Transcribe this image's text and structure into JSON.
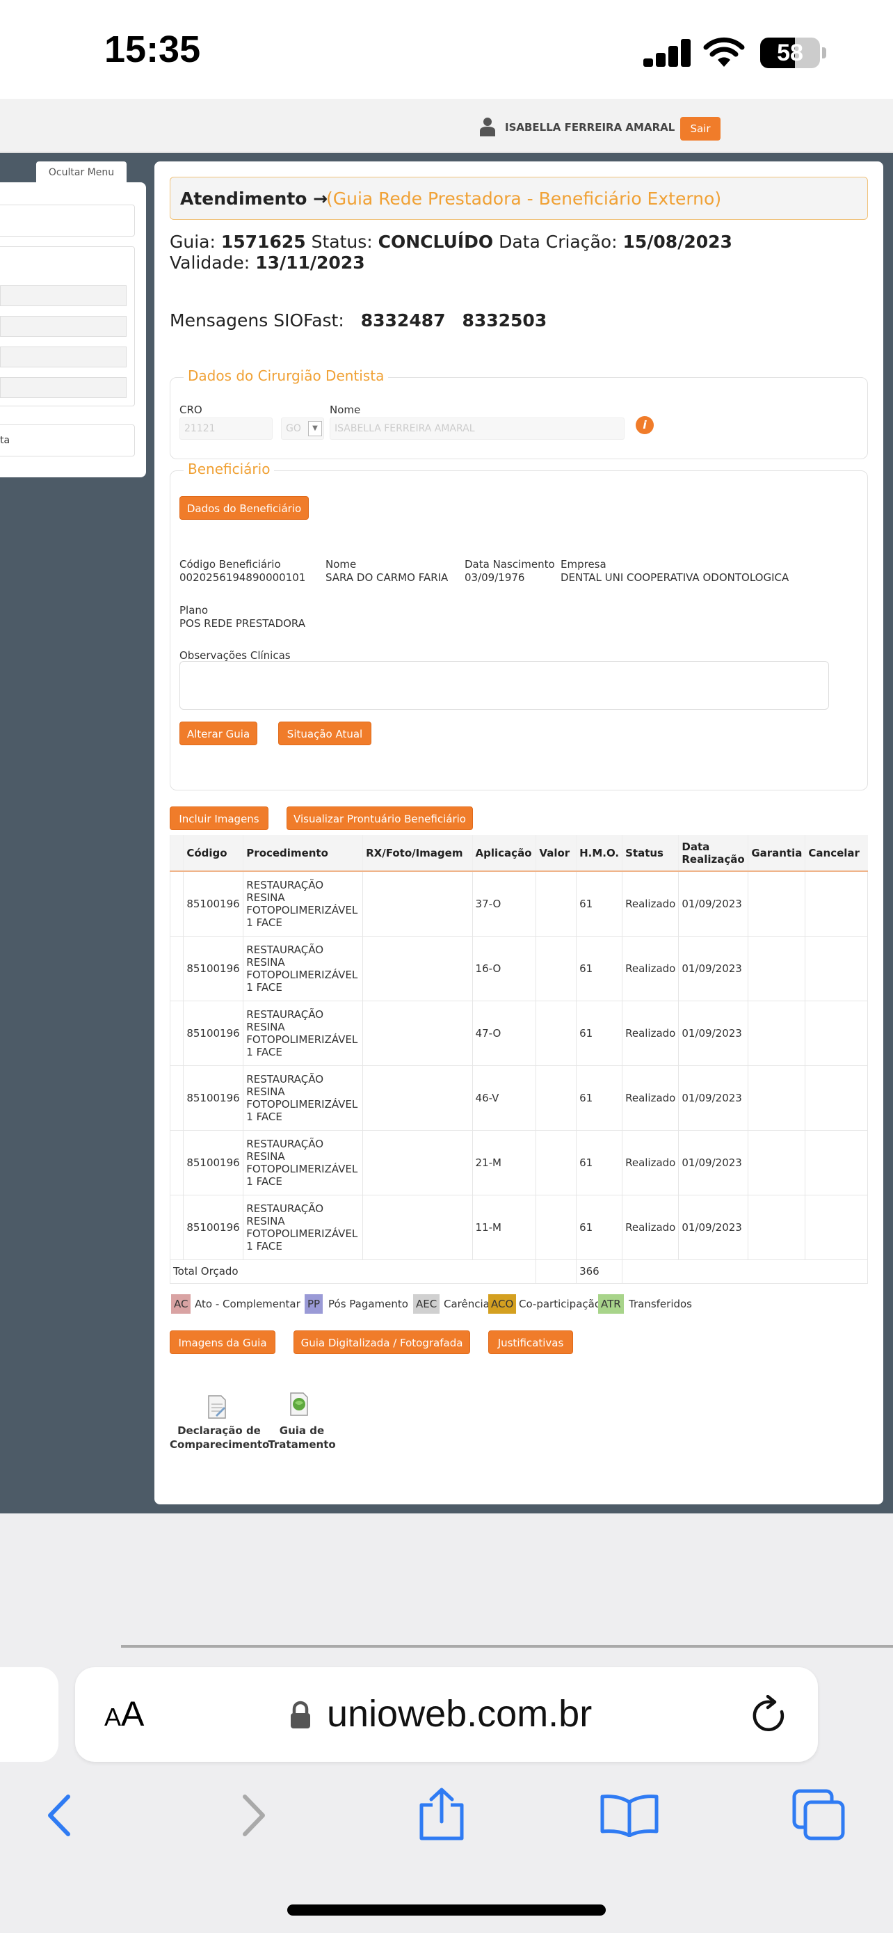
{
  "status_bar": {
    "time": "15:35",
    "battery": "58",
    "battery_level": 0.58
  },
  "header": {
    "user_name": "ISABELLA FERREIRA AMARAL",
    "logout_label": "Sair"
  },
  "sidebar": {
    "hide_menu_label": "Ocultar Menu",
    "partial_text": "ta"
  },
  "title": {
    "prefix": "Atendimento →",
    "context": "(Guia Rede Prestadora - Beneficiário Externo)"
  },
  "guia": {
    "guia_label": "Guia:",
    "guia_number": "1571625",
    "status_label": "Status:",
    "status_value": "CONCLUÍDO",
    "created_label": "Data Criação:",
    "created_value": "15/08/2023",
    "validity_label": "Validade:",
    "validity_value": "13/11/2023"
  },
  "messages": {
    "label": "Mensagens SIOFast:",
    "codes": [
      "8332487",
      "8332503"
    ]
  },
  "dentist": {
    "legend": "Dados do Cirurgião Dentista",
    "cro_label": "CRO",
    "cro_value": "21121",
    "uf_value": "GO",
    "name_label": "Nome",
    "name_value": "ISABELLA FERREIRA AMARAL"
  },
  "beneficiary": {
    "legend": "Beneficiário",
    "data_button": "Dados do Beneficiário",
    "code_label": "Código Beneficiário",
    "code_value": "0020256194890000101",
    "name_label": "Nome",
    "name_value": "SARA DO CARMO FARIA",
    "birth_label": "Data Nascimento",
    "birth_value": "03/09/1976",
    "company_label": "Empresa",
    "company_value": "DENTAL UNI COOPERATIVA ODONTOLOGICA",
    "plan_label": "Plano",
    "plan_value": "POS REDE PRESTADORA",
    "obs_label": "Observações Clínicas",
    "alter_button": "Alterar Guia",
    "situation_button": "Situação Atual"
  },
  "actions": {
    "include_images": "Incluir Imagens",
    "view_record": "Visualizar Prontuário Beneficiário"
  },
  "table": {
    "headers": [
      "Código",
      "Procedimento",
      "RX/Foto/Imagem",
      "Aplicação",
      "Valor",
      "H.M.O.",
      "Status",
      "Data Realização",
      "Garantia",
      "Cancelar"
    ],
    "rows": [
      {
        "code": "85100196",
        "procedure": "RESTAURAÇÃO RESINA FOTOPOLIMERIZÁVEL 1 FACE",
        "rx": "",
        "application": "37-O",
        "value": "",
        "hmo": "61",
        "status": "Realizado",
        "date": "01/09/2023"
      },
      {
        "code": "85100196",
        "procedure": "RESTAURAÇÃO RESINA FOTOPOLIMERIZÁVEL 1 FACE",
        "rx": "",
        "application": "16-O",
        "value": "",
        "hmo": "61",
        "status": "Realizado",
        "date": "01/09/2023"
      },
      {
        "code": "85100196",
        "procedure": "RESTAURAÇÃO RESINA FOTOPOLIMERIZÁVEL 1 FACE",
        "rx": "",
        "application": "47-O",
        "value": "",
        "hmo": "61",
        "status": "Realizado",
        "date": "01/09/2023"
      },
      {
        "code": "85100196",
        "procedure": "RESTAURAÇÃO RESINA FOTOPOLIMERIZÁVEL 1 FACE",
        "rx": "",
        "application": "46-V",
        "value": "",
        "hmo": "61",
        "status": "Realizado",
        "date": "01/09/2023"
      },
      {
        "code": "85100196",
        "procedure": "RESTAURAÇÃO RESINA FOTOPOLIMERIZÁVEL 1 FACE",
        "rx": "",
        "application": "21-M",
        "value": "",
        "hmo": "61",
        "status": "Realizado",
        "date": "01/09/2023"
      },
      {
        "code": "85100196",
        "procedure": "RESTAURAÇÃO RESINA FOTOPOLIMERIZÁVEL 1 FACE",
        "rx": "",
        "application": "11-M",
        "value": "",
        "hmo": "61",
        "status": "Realizado",
        "date": "01/09/2023"
      }
    ],
    "total_label": "Total Orçado",
    "total_value": "366"
  },
  "legend": [
    {
      "code": "AC",
      "text": "Ato - Complementar",
      "color": "#d9a3a3"
    },
    {
      "code": "PP",
      "text": "Pós Pagamento",
      "color": "#9a9ad6"
    },
    {
      "code": "AEC",
      "text": "Carência",
      "color": "#d0d0d0"
    },
    {
      "code": "ACO",
      "text": "Co-participação",
      "color": "#d4a020"
    },
    {
      "code": "ATR",
      "text": "Transferidos",
      "color": "#a8d48a"
    }
  ],
  "bottom_buttons": {
    "images": "Imagens da Guia",
    "digitized": "Guia Digitalizada / Fotografada",
    "justifications": "Justificativas"
  },
  "docs": {
    "attendance_line1": "Declaração de",
    "attendance_line2": "Comparecimento",
    "treatment_line1": "Guia de",
    "treatment_line2": "Tratamento"
  },
  "browser": {
    "aa_label": "AA",
    "url": "unioweb.com.br"
  },
  "colors": {
    "accent": "#f07c2a",
    "legend_orange": "#f0a135",
    "dark_bg": "#4d5b67"
  }
}
